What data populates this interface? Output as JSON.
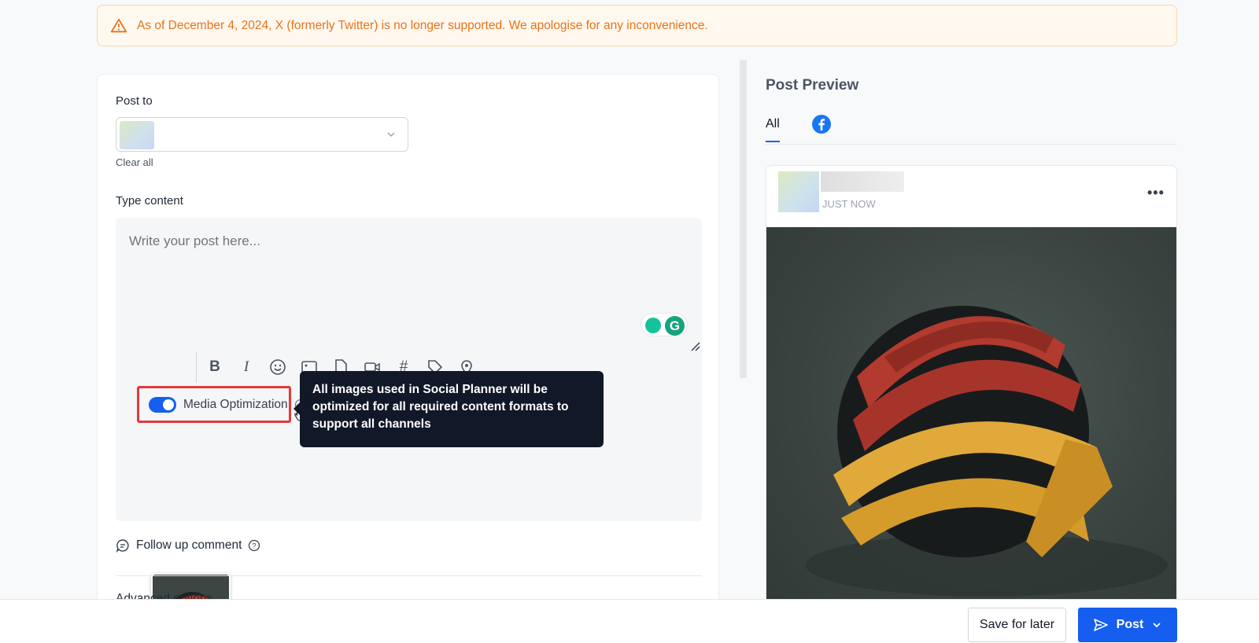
{
  "banner": {
    "message": "As of December 4, 2024, X (formerly Twitter) is no longer supported. We apologise for any inconvenience.",
    "icon": "warning-icon",
    "color": "#e8731a"
  },
  "editor": {
    "post_to_label": "Post to",
    "clear_all": "Clear all",
    "type_content_label": "Type content",
    "content_placeholder": "Write your post here...",
    "toolbar_icons": [
      "bold-icon",
      "italic-icon",
      "emoji-icon",
      "image-icon",
      "file-icon",
      "video-icon",
      "hashtag-icon",
      "tag-icon",
      "location-icon"
    ],
    "media_optimization_label": "Media Optimization",
    "media_optimization_enabled": true,
    "tooltip_text": "All images used in Social Planner will be optimized for all required content formats to support all channels",
    "follow_up_label": "Follow up comment",
    "advanced_options_label": "Advanced options"
  },
  "preview": {
    "title": "Post Preview",
    "tabs": [
      {
        "label": "All",
        "active": true
      },
      {
        "icon": "facebook-icon",
        "active": false
      }
    ],
    "post_time": "JUST NOW",
    "more_label": "•••"
  },
  "actions": {
    "save_label": "Save for later",
    "post_label": "Post"
  },
  "colors": {
    "accent": "#155eef",
    "highlight_border": "#e5383b",
    "tooltip_bg": "#111827"
  }
}
